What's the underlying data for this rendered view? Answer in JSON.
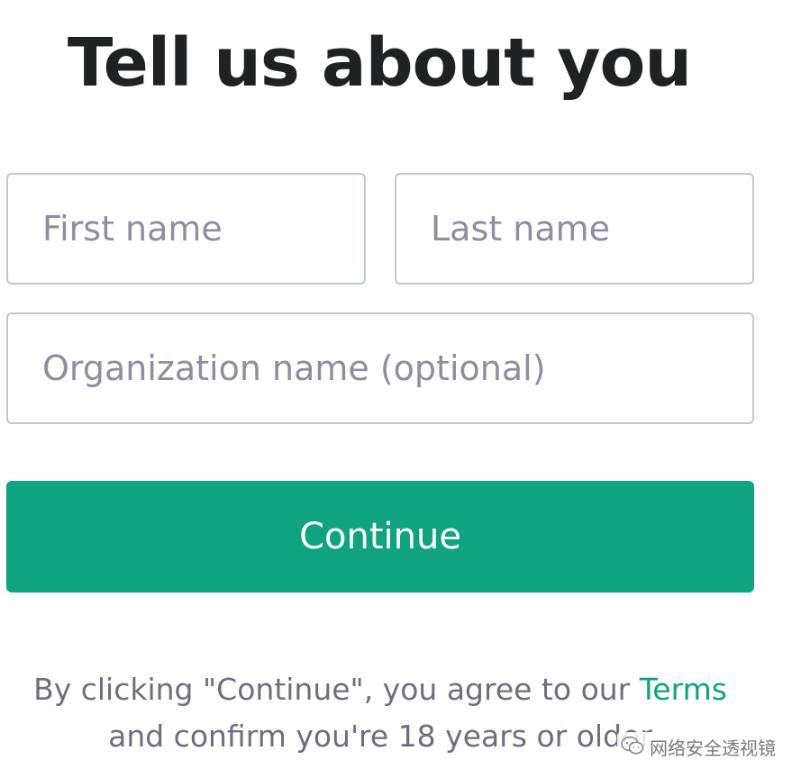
{
  "header": {
    "title": "Tell us about you"
  },
  "form": {
    "first_name": {
      "placeholder": "First name",
      "value": ""
    },
    "last_name": {
      "placeholder": "Last name",
      "value": ""
    },
    "organization": {
      "placeholder": "Organization name (optional)",
      "value": ""
    },
    "continue_label": "Continue"
  },
  "legal": {
    "prefix": "By clicking \"Continue\", you agree to our ",
    "terms_link": "Terms",
    "suffix": "and confirm you're 18 years or older"
  },
  "watermark": {
    "text": "网络安全透视镜",
    "icon": "wechat-icon"
  },
  "colors": {
    "accent": "#10a37f",
    "title": "#202123",
    "placeholder": "#8e8ea0",
    "border": "#c2c8d0",
    "muted_text": "#6e6e80"
  }
}
